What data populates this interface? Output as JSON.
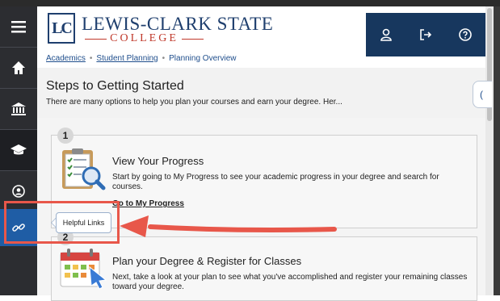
{
  "logo": {
    "monogram": "LC",
    "name_line1": "LEWIS-CLARK STATE",
    "name_line2": "COLLEGE"
  },
  "header": {
    "icons": [
      "user-icon",
      "sign-out-icon",
      "help-icon"
    ]
  },
  "sidebar": {
    "items": [
      {
        "icon": "menu-icon"
      },
      {
        "icon": "home-icon"
      },
      {
        "icon": "bank-icon"
      },
      {
        "icon": "graduation-cap-icon",
        "active": true
      },
      {
        "icon": "user-circle-icon"
      },
      {
        "icon": "link-icon",
        "label": "Helpful Links"
      }
    ]
  },
  "breadcrumb": {
    "items": [
      "Academics",
      "Student Planning",
      "Planning Overview"
    ]
  },
  "page": {
    "title": "Steps to Getting Started",
    "subtitle": "There are many options to help you plan your courses and earn your degree. Her..."
  },
  "steps": [
    {
      "number": "1",
      "title": "View Your Progress",
      "description": "Start by going to My Progress to see your academic progress in your degree and search for courses.",
      "link": "Go to My Progress",
      "icon": "clipboard-search-icon"
    },
    {
      "number": "2",
      "title": "Plan your Degree & Register for Classes",
      "description": "Next, take a look at your plan to see what you've accomplished and register your remaining classes toward your degree.",
      "icon": "calendar-icon"
    }
  ],
  "tooltip": {
    "text": "Helpful Links"
  },
  "colors": {
    "sidebar": "#2c2d31",
    "sidebar_active": "#1f5da5",
    "header_actions": "#17375e",
    "brand_navy": "#1f3f6e",
    "brand_red": "#c0392b",
    "annotation": "#e8574a"
  }
}
